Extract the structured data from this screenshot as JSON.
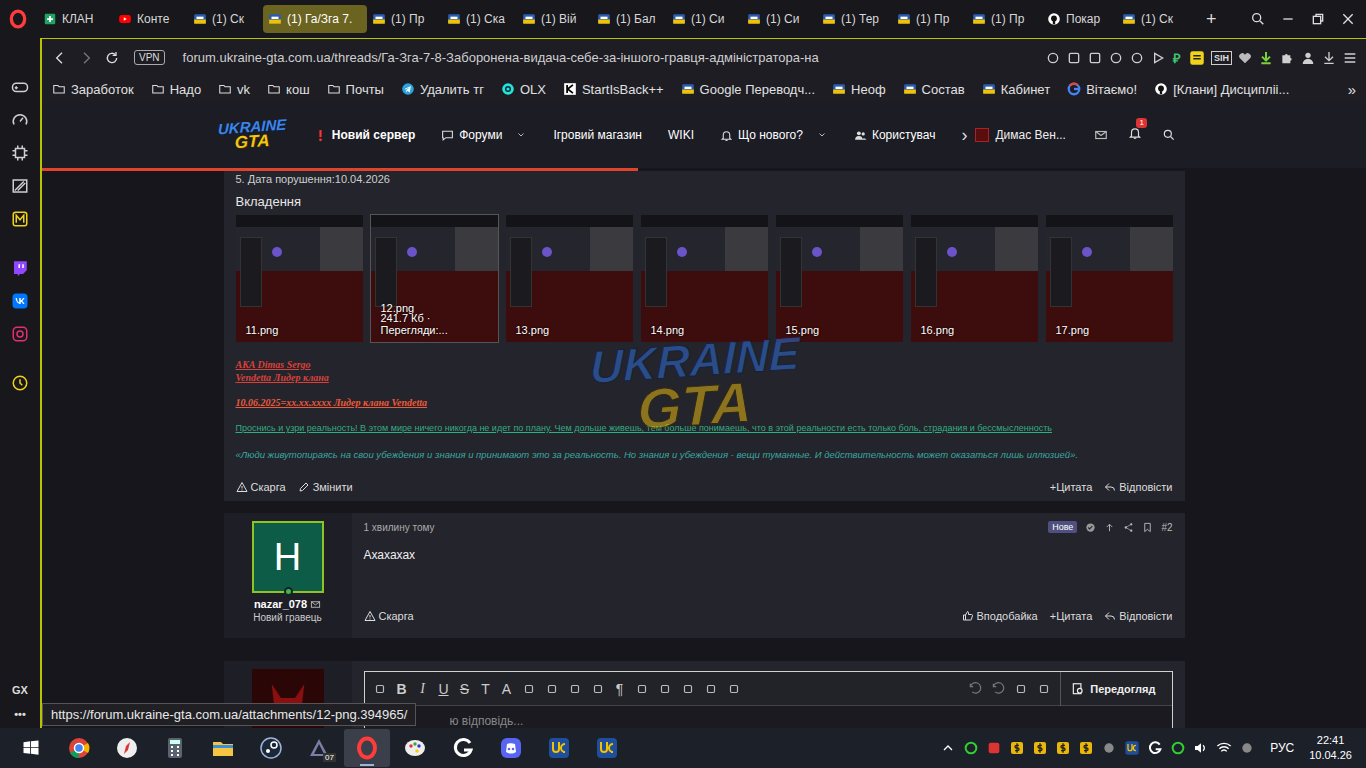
{
  "tabbar": {
    "tabs": [
      {
        "label": "КЛАН",
        "kind": "sheets",
        "selected": false
      },
      {
        "label": "Конте",
        "kind": "youtube",
        "selected": false
      },
      {
        "label": "(1) Ск",
        "kind": "forum",
        "selected": false
      },
      {
        "label": "(1) Га/Зга 7.",
        "kind": "forum",
        "selected": true
      },
      {
        "label": "(1) Пр",
        "kind": "forum",
        "selected": false
      },
      {
        "label": "(1) Ска",
        "kind": "forum",
        "selected": false
      },
      {
        "label": "(1) Вій",
        "kind": "forum",
        "selected": false
      },
      {
        "label": "(1) Бал",
        "kind": "forum",
        "selected": false
      },
      {
        "label": "(1) Си",
        "kind": "forum",
        "selected": false
      },
      {
        "label": "(1) Си",
        "kind": "forum",
        "selected": false
      },
      {
        "label": "(1) Тер",
        "kind": "forum",
        "selected": false
      },
      {
        "label": "(1) Пр",
        "kind": "forum",
        "selected": false
      },
      {
        "label": "(1) Пр",
        "kind": "forum",
        "selected": false
      },
      {
        "label": "Покар",
        "kind": "github",
        "selected": false
      },
      {
        "label": "(1) Ск",
        "kind": "forum",
        "selected": false
      }
    ],
    "new_tab": "+"
  },
  "address_bar": {
    "vpn": "VPN",
    "url": "forum.ukraine-gta.com.ua/threads/Га-Зга-7-8-Заборонена-видача-себе-за-іншого-гравця-адміністратора-на",
    "extensions": [
      {
        "label": "₽",
        "kind": "ruble"
      },
      {
        "label": "SIH",
        "kind": "sih"
      }
    ]
  },
  "bookmarks": [
    {
      "label": "Заработок",
      "kind": "folder"
    },
    {
      "label": "Надо",
      "kind": "folder"
    },
    {
      "label": "vk",
      "kind": "folder"
    },
    {
      "label": "кош",
      "kind": "folder"
    },
    {
      "label": "Почты",
      "kind": "folder"
    },
    {
      "label": "Удалить тг",
      "kind": "telegram"
    },
    {
      "label": "OLX",
      "kind": "olx"
    },
    {
      "label": "StartIsBack++",
      "kind": "k"
    },
    {
      "label": "Google Переводч...",
      "kind": "forum"
    },
    {
      "label": "Неоф",
      "kind": "forum"
    },
    {
      "label": "Состав",
      "kind": "forum"
    },
    {
      "label": "Кабинет",
      "kind": "forum"
    },
    {
      "label": "Вітаємо!",
      "kind": "google"
    },
    {
      "label": "[Клани] Дисципліі...",
      "kind": "github"
    }
  ],
  "bookmarks_more": "»",
  "sidebar": {
    "footer": [
      "GX",
      "•••"
    ]
  },
  "forum": {
    "logo": {
      "line1": "UKRAINE",
      "line2": "GTA"
    },
    "nav": [
      {
        "label": "Новий сервер",
        "kind": "alert",
        "dropdown": false
      },
      {
        "label": "Форуми",
        "kind": "forums",
        "dropdown": true
      },
      {
        "label": "Ігровий магазин",
        "kind": "plain",
        "dropdown": false
      },
      {
        "label": "WIKI",
        "kind": "plain",
        "dropdown": false
      },
      {
        "label": "Що нового?",
        "kind": "bell",
        "dropdown": true
      },
      {
        "label": "Користувач",
        "kind": "users",
        "dropdown": false
      }
    ],
    "nav_more": "›",
    "user": "Димас Вен...",
    "notifications": "1",
    "load_progress": 0.45
  },
  "post1": {
    "field": "5. Дата порушення:10.04.2026",
    "attachments_title": "Вкладення",
    "attachments": [
      {
        "name": "11.png",
        "hovered": false
      },
      {
        "name": "12.png",
        "meta": "241.7 Кб · Перегляди:...",
        "hovered": true
      },
      {
        "name": "13.png",
        "hovered": false
      },
      {
        "name": "14.png",
        "hovered": false
      },
      {
        "name": "15.png",
        "hovered": false
      },
      {
        "name": "16.png",
        "hovered": false
      },
      {
        "name": "17.png",
        "hovered": false
      }
    ],
    "signature": [
      {
        "text": "AKA Dimas Sergo",
        "kind": "red"
      },
      {
        "text": "Vendetta Лидер клана",
        "kind": "red"
      },
      {
        "text": "10.06.2025=xx.xx.xxxx Лидер клана Vendetta",
        "kind": "bold"
      },
      {
        "text": "Проснись и узри реальность! В этом мире ничего никогда не идет по плану. Чем дольше живешь, тем больше понимаешь, что в этой реальности есть только боль, страдания и бессмысленность",
        "kind": "green"
      },
      {
        "text": "«Люди живутопираясь на свои убеждения и знания и принимают это за реальность. Но знания и убеждения - вещи туманные. И действительность может оказаться лишь иллюзией».",
        "kind": "teal"
      }
    ],
    "actions_left": [
      "Скарга",
      "Змінити"
    ],
    "actions_right": [
      "+Цитата",
      "Відповісти"
    ]
  },
  "post2": {
    "avatar": "H",
    "username": "nazar_078",
    "online": true,
    "role": "Новий гравець",
    "time": "1 хвилину тому",
    "badge": "Нове",
    "number": "#2",
    "body": "Ахахахах",
    "actions_left": [
      "Скарга"
    ],
    "actions_right": [
      "Вподобайка",
      "+Цитата",
      "Відповісти"
    ]
  },
  "editor": {
    "tools": [
      {
        "kind": "icon",
        "label": ""
      },
      {
        "kind": "bold",
        "label": "B"
      },
      {
        "kind": "italic",
        "label": "I"
      },
      {
        "kind": "underline",
        "label": "U"
      },
      {
        "kind": "strike",
        "label": "S"
      },
      {
        "kind": "text",
        "label": "T"
      },
      {
        "kind": "text",
        "label": "A"
      },
      {
        "kind": "icon",
        "label": ""
      },
      {
        "kind": "icon",
        "label": ""
      },
      {
        "kind": "icon",
        "label": ""
      },
      {
        "kind": "icon",
        "label": ""
      },
      {
        "kind": "text",
        "label": "¶"
      },
      {
        "kind": "icon",
        "label": ""
      },
      {
        "kind": "icon",
        "label": ""
      },
      {
        "kind": "icon",
        "label": ""
      },
      {
        "kind": "icon",
        "label": ""
      },
      {
        "kind": "icon",
        "label": ""
      }
    ],
    "placeholder": "ю відповідь...",
    "preview": "Передогляд"
  },
  "watermark": {
    "line1": "UKRAINE",
    "line2": "GTA"
  },
  "status_url": "https://forum.ukraine-gta.com.ua/attachments/12-png.394965/",
  "taskbar": {
    "apps": [
      {
        "kind": "chrome",
        "selected": false
      },
      {
        "kind": "compass",
        "selected": false
      },
      {
        "kind": "calculator",
        "selected": false
      },
      {
        "kind": "explorer",
        "selected": false
      },
      {
        "kind": "steam",
        "selected": false
      },
      {
        "kind": "mimic",
        "selected": false,
        "badge": "07"
      },
      {
        "kind": "opera",
        "selected": true
      },
      {
        "kind": "paint",
        "selected": false
      },
      {
        "kind": "g",
        "selected": false
      },
      {
        "kind": "discord",
        "selected": false
      },
      {
        "kind": "ug",
        "selected": false
      },
      {
        "kind": "ug",
        "selected": false
      }
    ],
    "tray": {
      "lang": "РУС",
      "time": "22:41",
      "date": "10.04.26"
    }
  }
}
